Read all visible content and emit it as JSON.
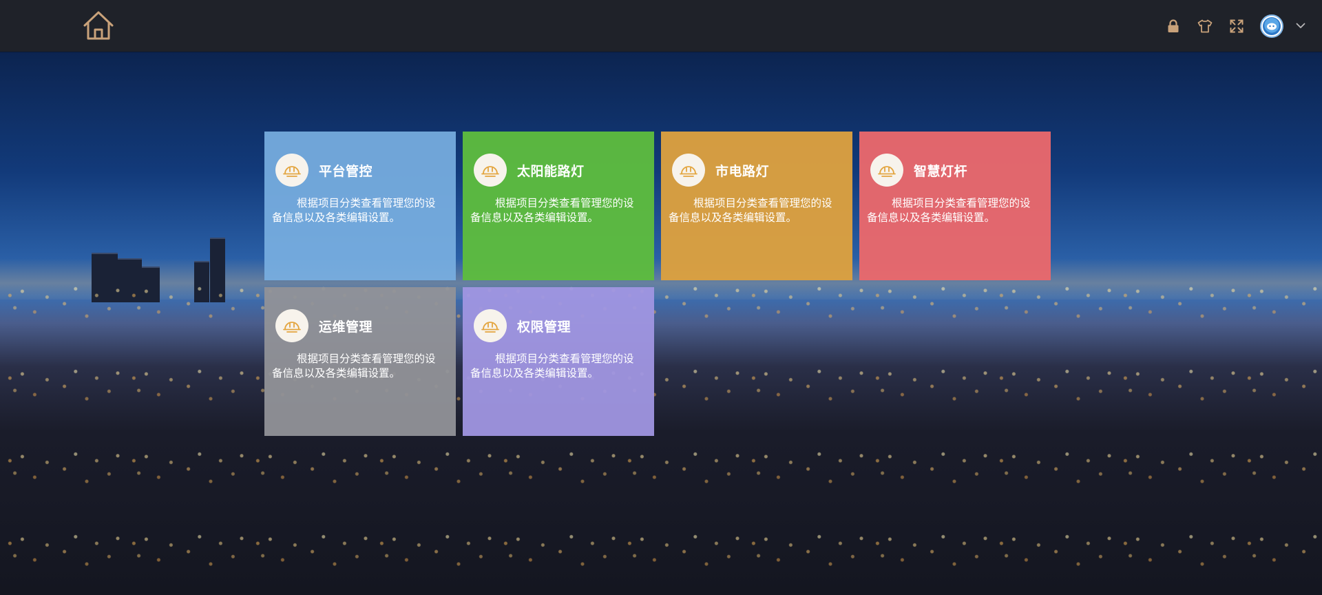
{
  "header": {
    "icons": [
      "home-icon",
      "lock-icon",
      "tshirt-icon",
      "fullscreen-icon",
      "avatar",
      "chevron-down-icon"
    ]
  },
  "tiles": [
    {
      "title": "平台管控",
      "desc": "根据项目分类查看管理您的设备信息以及各类编辑设置。",
      "color": "#6aa4d8",
      "icon": "helmet-icon"
    },
    {
      "title": "太阳能路灯",
      "desc": "根据项目分类查看管理您的设备信息以及各类编辑设置。",
      "color": "#5dbb3f",
      "icon": "helmet-icon"
    },
    {
      "title": "市电路灯",
      "desc": "根据项目分类查看管理您的设备信息以及各类编辑设置。",
      "color": "#dba040",
      "icon": "helmet-icon"
    },
    {
      "title": "智慧灯杆",
      "desc": "根据项目分类查看管理您的设备信息以及各类编辑设置。",
      "color": "#e8686c",
      "icon": "helmet-icon"
    },
    {
      "title": "运维管理",
      "desc": "根据项目分类查看管理您的设备信息以及各类编辑设置。",
      "color": "#8c8d94",
      "icon": "helmet-icon"
    },
    {
      "title": "权限管理",
      "desc": "根据项目分类查看管理您的设备信息以及各类编辑设置。",
      "color": "#9a90d6",
      "icon": "helmet-icon"
    }
  ],
  "colors": {
    "topbar": "#1f2229",
    "icon_accent": "#c9a27a",
    "tile_icon_bg": "#f7f3ec",
    "tile_icon_stroke": "#e3a53f"
  }
}
